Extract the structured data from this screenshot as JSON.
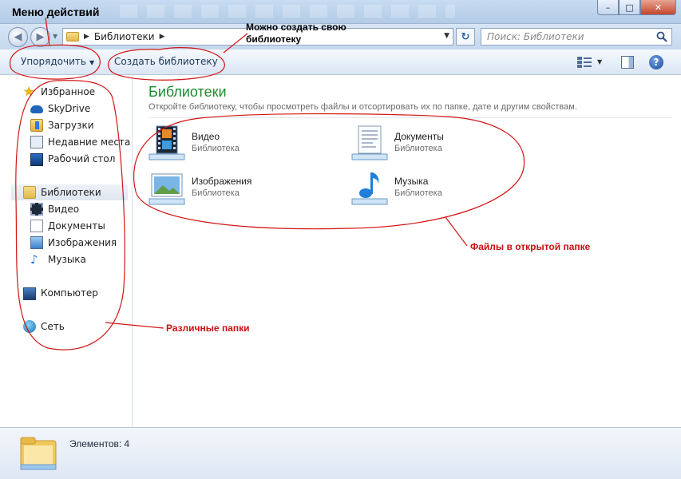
{
  "window": {
    "controls": {
      "minimize": "–",
      "maximize": "□",
      "close": "✕"
    }
  },
  "nav": {
    "back_glyph": "◀",
    "forward_glyph": "▶",
    "history_glyph": "▼",
    "breadcrumb": [
      "Библиотеки"
    ],
    "refresh_glyph": "↻",
    "search_placeholder": "Поиск: Библиотеки"
  },
  "toolbar": {
    "organize_label": "Упорядочить",
    "create_library_label": "Создать библиотеку",
    "help_label": "?"
  },
  "sidebar": {
    "favorites": [
      {
        "label": "Избранное",
        "icon": "star-icon"
      },
      {
        "label": "SkyDrive",
        "icon": "cloud-icon"
      },
      {
        "label": "Загрузки",
        "icon": "downloads-folder-icon"
      },
      {
        "label": "Недавние места",
        "icon": "recent-places-icon"
      },
      {
        "label": "Рабочий стол",
        "icon": "desktop-icon"
      }
    ],
    "libraries": [
      {
        "label": "Библиотеки",
        "icon": "libraries-folder-icon"
      },
      {
        "label": "Видео",
        "icon": "video-icon"
      },
      {
        "label": "Документы",
        "icon": "documents-icon"
      },
      {
        "label": "Изображения",
        "icon": "pictures-icon"
      },
      {
        "label": "Музыка",
        "icon": "music-icon"
      }
    ],
    "computer": {
      "label": "Компьютер",
      "icon": "computer-icon"
    },
    "network": {
      "label": "Сеть",
      "icon": "network-icon"
    }
  },
  "main": {
    "title": "Библиотеки",
    "subtitle": "Откройте библиотеку, чтобы просмотреть файлы и отсортировать их по папке, дате и другим свойствам.",
    "libraries": [
      {
        "name": "Видео",
        "kind": "Библиотека",
        "icon": "video-library-icon"
      },
      {
        "name": "Документы",
        "kind": "Библиотека",
        "icon": "documents-library-icon"
      },
      {
        "name": "Изображения",
        "kind": "Библиотека",
        "icon": "pictures-library-icon"
      },
      {
        "name": "Музыка",
        "kind": "Библиотека",
        "icon": "music-library-icon"
      }
    ]
  },
  "status": {
    "items_count": "Элементов: 4"
  },
  "annotations": {
    "action_menu": "Меню действий",
    "create_library_line1": "Можно создать свою",
    "create_library_line2": "библиотеку",
    "files_in_folder": "Файлы в открытой папке",
    "various_folders": "Различные папки",
    "color_dark": "#000000",
    "color_red": "#cc1010"
  }
}
